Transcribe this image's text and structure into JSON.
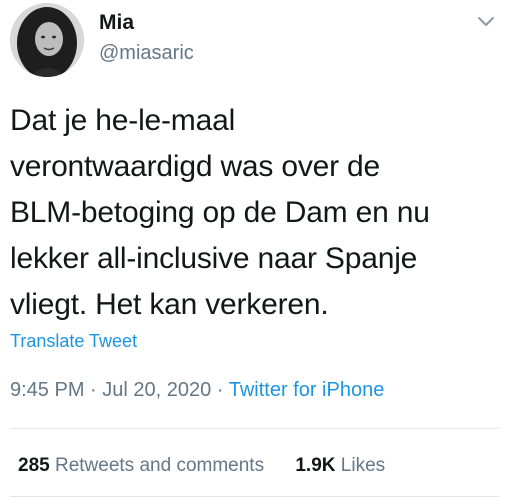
{
  "author": {
    "name": "Mia",
    "handle": "@miasaric"
  },
  "tweet": {
    "text": "Dat je he-le-maal\nverontwaardigd was over de\nBLM-betoging op de Dam en nu\nlekker all-inclusive naar Spanje\nvliegt. Het kan verkeren.",
    "translate_label": "Translate Tweet",
    "time": "9:45 PM",
    "separator": "·",
    "date": "Jul 20, 2020",
    "source": "Twitter for iPhone"
  },
  "stats": {
    "retweets_count": "285",
    "retweets_label": "Retweets and comments",
    "likes_count": "1.9K",
    "likes_label": "Likes"
  },
  "icons": {
    "menu": "chevron-down-icon"
  },
  "colors": {
    "link": "#1b95e0",
    "secondary_text": "#657786",
    "primary_text": "#14171a",
    "divider": "#e1e8ed"
  }
}
